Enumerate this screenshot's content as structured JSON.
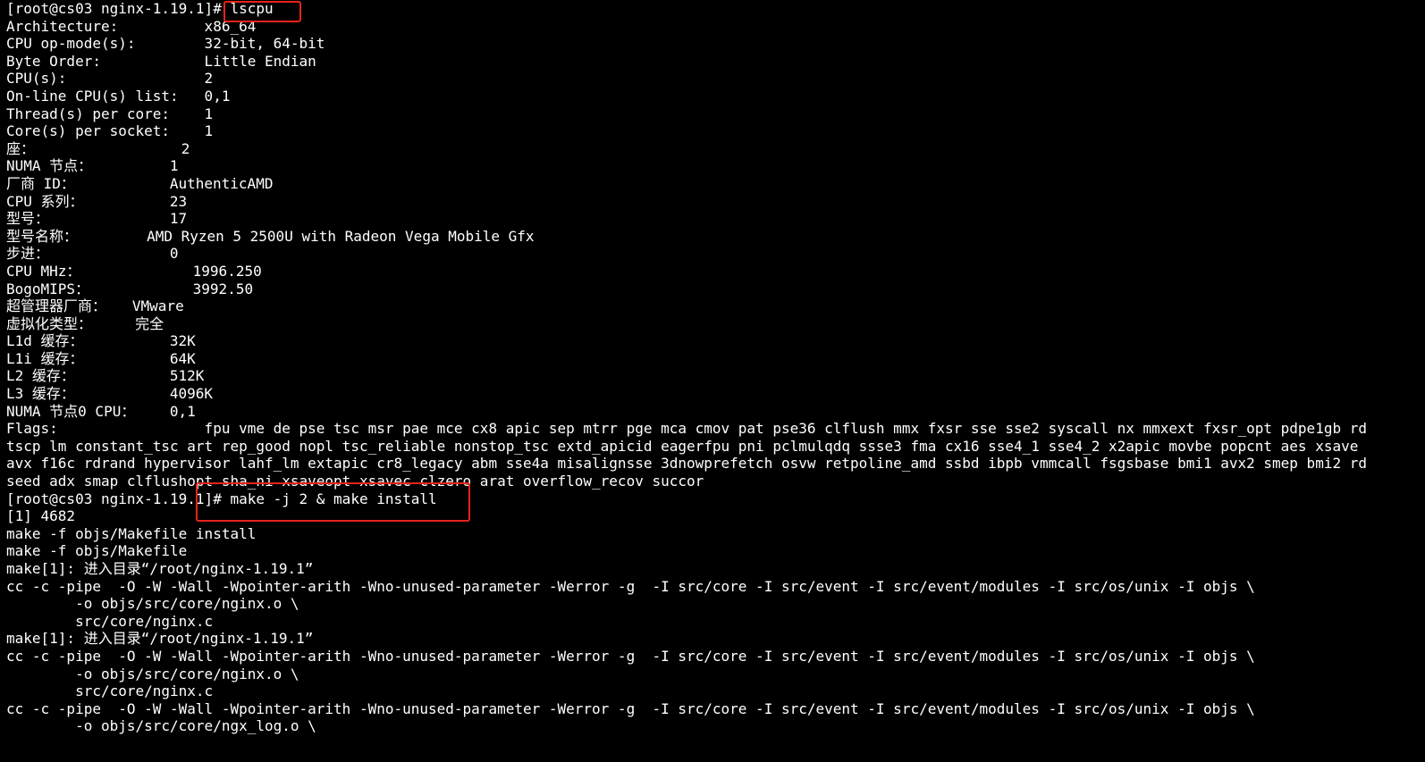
{
  "terminal": {
    "lines": [
      "[root@cs03 nginx-1.19.1]# lscpu",
      "Architecture:          x86_64",
      "CPU op-mode(s):        32-bit, 64-bit",
      "Byte Order:            Little Endian",
      "CPU(s):                2",
      "On-line CPU(s) list:   0,1",
      "Thread(s) per core:    1",
      "Core(s) per socket:    1",
      "座：                 2",
      "NUMA 节点：         1",
      "厂商 ID：           AuthenticAMD",
      "CPU 系列：          23",
      "型号：              17",
      "型号名称：        AMD Ryzen 5 2500U with Radeon Vega Mobile Gfx",
      "步进：              0",
      "CPU MHz：             1996.250",
      "BogoMIPS：            3992.50",
      "超管理器厂商：   VMware",
      "虚拟化类型：     完全",
      "L1d 缓存：          32K",
      "L1i 缓存：          64K",
      "L2 缓存：           512K",
      "L3 缓存：           4096K",
      "NUMA 节点0 CPU：    0,1",
      "Flags:                 fpu vme de pse tsc msr pae mce cx8 apic sep mtrr pge mca cmov pat pse36 clflush mmx fxsr sse sse2 syscall nx mmxext fxsr_opt pdpe1gb rd",
      "tscp lm constant_tsc art rep_good nopl tsc_reliable nonstop_tsc extd_apicid eagerfpu pni pclmulqdq ssse3 fma cx16 sse4_1 sse4_2 x2apic movbe popcnt aes xsave",
      "avx f16c rdrand hypervisor lahf_lm extapic cr8_legacy abm sse4a misalignsse 3dnowprefetch osvw retpoline_amd ssbd ibpb vmmcall fsgsbase bmi1 avx2 smep bmi2 rd",
      "seed adx smap clflushopt sha_ni xsaveopt xsavec clzero arat overflow_recov succor",
      "[root@cs03 nginx-1.19.1]# make -j 2 & make install",
      "[1] 4682",
      "make -f objs/Makefile install",
      "make -f objs/Makefile",
      "make[1]: 进入目录“/root/nginx-1.19.1”",
      "cc -c -pipe  -O -W -Wall -Wpointer-arith -Wno-unused-parameter -Werror -g  -I src/core -I src/event -I src/event/modules -I src/os/unix -I objs \\",
      "        -o objs/src/core/nginx.o \\",
      "        src/core/nginx.c",
      "make[1]: 进入目录“/root/nginx-1.19.1”",
      "cc -c -pipe  -O -W -Wall -Wpointer-arith -Wno-unused-parameter -Werror -g  -I src/core -I src/event -I src/event/modules -I src/os/unix -I objs \\",
      "        -o objs/src/core/nginx.o \\",
      "        src/core/nginx.c",
      "cc -c -pipe  -O -W -Wall -Wpointer-arith -Wno-unused-parameter -Werror -g  -I src/core -I src/event -I src/event/modules -I src/os/unix -I objs \\",
      "        -o objs/src/core/ngx_log.o \\"
    ]
  },
  "annotation_color": "#e8231a"
}
